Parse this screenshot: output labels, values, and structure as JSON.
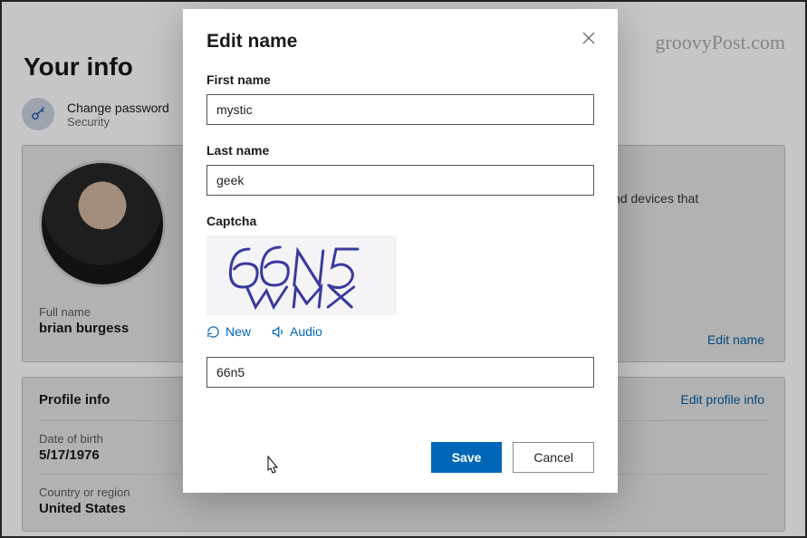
{
  "watermark": "groovyPost.com",
  "page": {
    "title": "Your info",
    "change_password": "Change password",
    "security_sub": "Security"
  },
  "card_name": {
    "desc_fragment": "apps and devices that",
    "full_name_label": "Full name",
    "full_name_value": "brian burgess",
    "edit_link": "Edit name"
  },
  "card_profile": {
    "title": "Profile info",
    "edit_link": "Edit profile info",
    "dob_label": "Date of birth",
    "dob_value": "5/17/1976",
    "country_label": "Country or region",
    "country_value": "United States"
  },
  "modal": {
    "title": "Edit name",
    "first_name_label": "First name",
    "first_name_value": "mystic",
    "last_name_label": "Last name",
    "last_name_value": "geek",
    "captcha_label": "Captcha",
    "captcha_text": "66N5 WMX",
    "captcha_new": "New",
    "captcha_audio": "Audio",
    "captcha_input": "66n5",
    "save": "Save",
    "cancel": "Cancel"
  }
}
